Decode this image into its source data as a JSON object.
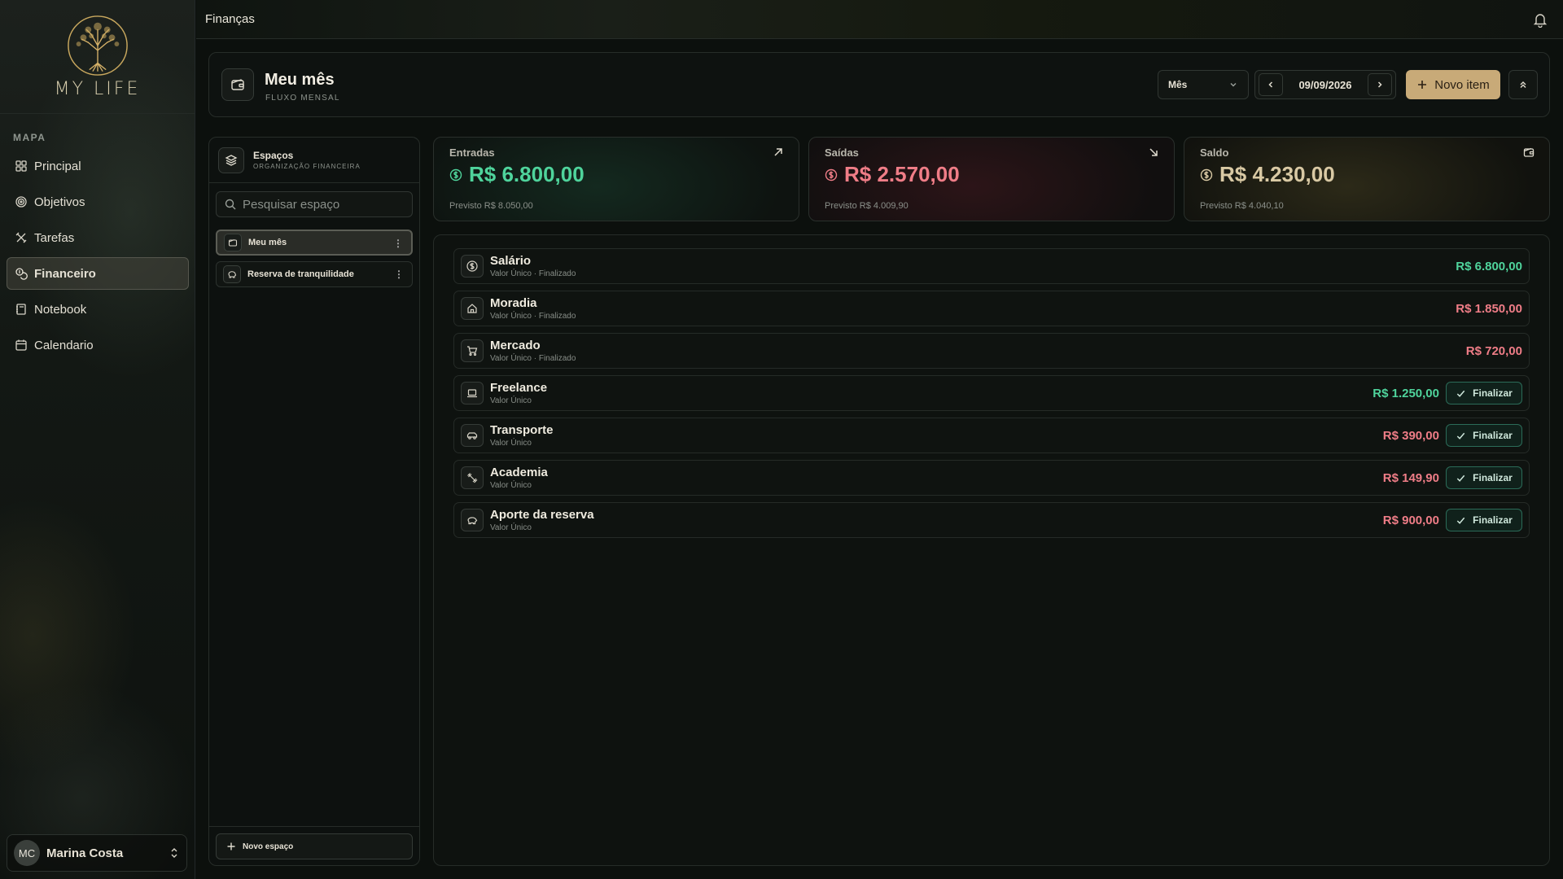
{
  "app": {
    "brand": "MY LIFE",
    "topbar_title": "Finanças"
  },
  "sidebar": {
    "section_label": "MAPA",
    "items": [
      {
        "label": "Principal",
        "icon": "grid-icon"
      },
      {
        "label": "Objetivos",
        "icon": "target-icon"
      },
      {
        "label": "Tarefas",
        "icon": "tools-icon"
      },
      {
        "label": "Financeiro",
        "icon": "coins-icon",
        "active": true
      },
      {
        "label": "Notebook",
        "icon": "notebook-icon"
      },
      {
        "label": "Calendario",
        "icon": "calendar-icon"
      }
    ],
    "user": {
      "initials": "MC",
      "name": "Marina Costa"
    }
  },
  "header": {
    "title": "Meu mês",
    "subtitle": "FLUXO MENSAL",
    "period_select": "Mês",
    "date": "09/09/2026",
    "new_item_label": "Novo item"
  },
  "spaces": {
    "title": "Espaços",
    "subtitle": "ORGANIZAÇÃO FINANCEIRA",
    "search_placeholder": "Pesquisar espaço",
    "items": [
      {
        "label": "Meu mês",
        "active": true
      },
      {
        "label": "Reserva de tranquilidade",
        "active": false
      }
    ],
    "new_space_label": "Novo espaço"
  },
  "stats": {
    "income": {
      "label": "Entradas",
      "value": "R$ 6.800,00",
      "forecast": "Previsto R$ 8.050,00",
      "color": "#4fd49c"
    },
    "expenses": {
      "label": "Saídas",
      "value": "R$ 2.570,00",
      "forecast": "Previsto R$ 4.009,90",
      "color": "#ef7d87"
    },
    "balance": {
      "label": "Saldo",
      "value": "R$ 4.230,00",
      "forecast": "Previsto R$ 4.040,10",
      "color": "#d9c9a4"
    }
  },
  "transactions": {
    "finalize_label": "Finalizar",
    "items": [
      {
        "name": "Salário",
        "meta": "Valor Único · Finalizado",
        "amount": "R$ 6.800,00",
        "type": "income",
        "finalized": true,
        "icon": "dollar-icon"
      },
      {
        "name": "Moradia",
        "meta": "Valor Único · Finalizado",
        "amount": "R$ 1.850,00",
        "type": "expense",
        "finalized": true,
        "icon": "home-icon"
      },
      {
        "name": "Mercado",
        "meta": "Valor Único · Finalizado",
        "amount": "R$ 720,00",
        "type": "expense",
        "finalized": true,
        "icon": "cart-icon"
      },
      {
        "name": "Freelance",
        "meta": "Valor Único",
        "amount": "R$ 1.250,00",
        "type": "income",
        "finalized": false,
        "icon": "laptop-icon"
      },
      {
        "name": "Transporte",
        "meta": "Valor Único",
        "amount": "R$ 390,00",
        "type": "expense",
        "finalized": false,
        "icon": "car-icon"
      },
      {
        "name": "Academia",
        "meta": "Valor Único",
        "amount": "R$ 149,90",
        "type": "expense",
        "finalized": false,
        "icon": "dumbbell-icon"
      },
      {
        "name": "Aporte da reserva",
        "meta": "Valor Único",
        "amount": "R$ 900,00",
        "type": "expense",
        "finalized": false,
        "icon": "piggy-bank-icon"
      }
    ]
  }
}
